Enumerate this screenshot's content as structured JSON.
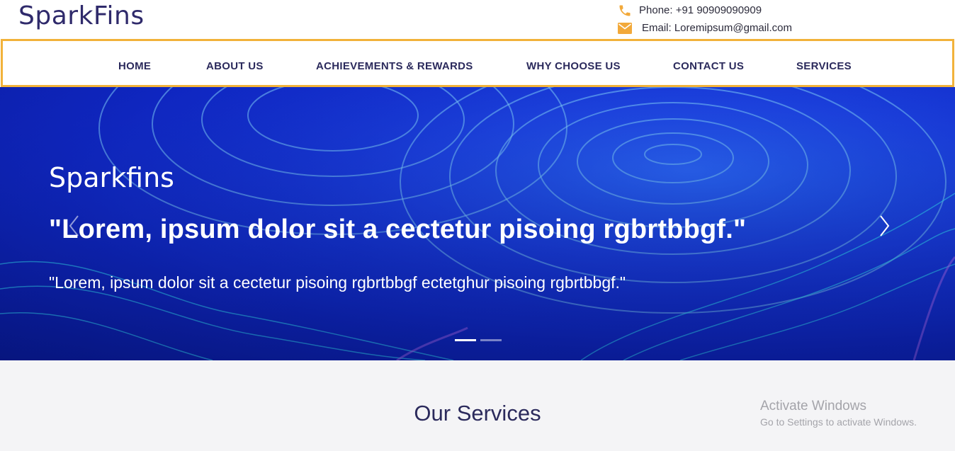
{
  "header": {
    "brand": "SparkFins",
    "phone": "Phone: +91 90909090909",
    "email": "Email: Loremipsum@gmail.com",
    "phone_icon": "phone-icon",
    "email_icon": "mail-icon",
    "icon_color": "#f2a93a"
  },
  "nav": {
    "accent": "#f2b23a",
    "items": [
      {
        "label": "HOME"
      },
      {
        "label": "ABOUT US"
      },
      {
        "label": "ACHIEVEMENTS & REWARDS"
      },
      {
        "label": "WHY CHOOSE US"
      },
      {
        "label": "CONTACT US"
      },
      {
        "label": "SERVICES"
      }
    ]
  },
  "hero": {
    "kicker": "Sparkfins",
    "headline": "\"Lorem, ipsum dolor sit a cectetur pisoing rgbrtbbgf.\"",
    "subtext": "\"Lorem, ipsum dolor sit a cectetur pisoing rgbrtbbgf ectetghur pisoing rgbrtbbgf.\"",
    "prev_icon": "chevron-left-icon",
    "next_icon": "chevron-right-icon",
    "slides": 2,
    "active_slide": 1
  },
  "services": {
    "title": "Our Services"
  },
  "watermark": {
    "line1": "Activate Windows",
    "line2": "Go to Settings to activate Windows."
  }
}
